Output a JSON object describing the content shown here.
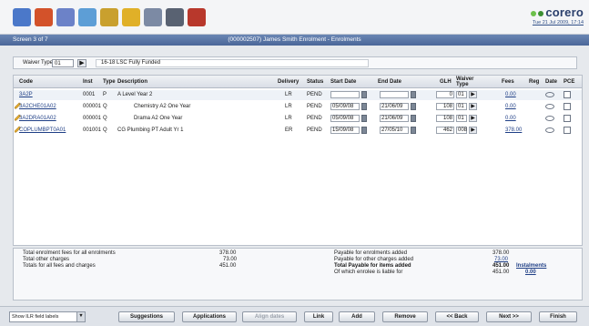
{
  "app": {
    "brand": "corero",
    "datetime": "Tue 21 Jul 2009, 17:14",
    "screen_label": "Screen 3 of 7",
    "window_title": "(000002507) James Smith Enrolment - Enrolments"
  },
  "toolbar": {
    "icons": [
      {
        "name": "home-icon",
        "color": "#4b78c9"
      },
      {
        "name": "students-icon",
        "color": "#d3522a"
      },
      {
        "name": "attachment-icon",
        "color": "#6c82c8"
      },
      {
        "name": "tasks-icon",
        "color": "#5d9ed6"
      },
      {
        "name": "search-icon",
        "color": "#c9a02e"
      },
      {
        "name": "edit-icon",
        "color": "#e0b028"
      },
      {
        "name": "calendar-icon",
        "color": "#7c8aa4"
      },
      {
        "name": "print-icon",
        "color": "#596272"
      },
      {
        "name": "briefcase-icon",
        "color": "#b8382c"
      }
    ]
  },
  "waiver": {
    "label": "Waiver Type",
    "value": "01",
    "description": "16-18 LSC Fully Funded"
  },
  "grid": {
    "headers": {
      "code": "Code",
      "inst": "Inst",
      "type": "Type",
      "description": "Description",
      "delivery": "Delivery",
      "status": "Status",
      "start_date": "Start Date",
      "end_date": "End Date",
      "glh": "GLH",
      "waiver_type": "Waiver Type",
      "fees": "Fees",
      "reg": "Reg",
      "date": "Date",
      "pce": "PCE"
    },
    "rows": [
      {
        "code": "3A2P",
        "inst": "0001",
        "type": "P",
        "description": "A Level Year 2",
        "delivery": "LR",
        "status": "PEND",
        "start": "",
        "end": "",
        "glh": "0",
        "waiver": "01",
        "fees": "0.00",
        "indent": 0,
        "pen": false
      },
      {
        "code": "3A2CHE01A02",
        "inst": "000001",
        "type": "Q",
        "description": "Chemistry A2 One Year",
        "delivery": "LR",
        "status": "PEND",
        "start": "05/09/08",
        "end": "21/06/09",
        "glh": "108",
        "waiver": "01",
        "fees": "0.00",
        "indent": 1,
        "pen": true
      },
      {
        "code": "3A2DRA01A02",
        "inst": "000001",
        "type": "Q",
        "description": "Drama A2 One Year",
        "delivery": "LR",
        "status": "PEND",
        "start": "05/09/08",
        "end": "21/06/09",
        "glh": "108",
        "waiver": "01",
        "fees": "0.00",
        "indent": 1,
        "pen": true
      },
      {
        "code": "COPLUMBPT0A01",
        "inst": "001001",
        "type": "Q",
        "description": "CG Plumbing PT Adult Yr 1",
        "delivery": "ER",
        "status": "PEND",
        "start": "15/09/08",
        "end": "27/05/10",
        "glh": "462",
        "waiver": "008",
        "fees": "378.00",
        "indent": 0,
        "pen": true
      }
    ]
  },
  "summary": {
    "left": [
      {
        "label": "Total enrolment fees for all enrolments",
        "value": "378.00"
      },
      {
        "label": "Total other charges",
        "value": "73.00"
      },
      {
        "label": "Totals for all fees and charges",
        "value": "451.00"
      }
    ],
    "right": [
      {
        "label": "Payable for enrolments added",
        "value": "378.00",
        "link": false,
        "bold": false
      },
      {
        "label": "Payable for other charges added",
        "value": "73.00",
        "link": true,
        "bold": false
      },
      {
        "label": "Total Payable for items added",
        "value": "451.00",
        "link": false,
        "bold": true
      },
      {
        "label": "Of which enrolee is liable for",
        "value": "451.00",
        "link": false,
        "bold": false
      }
    ],
    "instalments_label": "Instalments",
    "instalments_value": "0.00"
  },
  "footer": {
    "show_select": "Show ILR field labels",
    "buttons": [
      {
        "label": "Suggestions",
        "disabled": false
      },
      {
        "label": "Applications",
        "disabled": false
      },
      {
        "label": "Align dates",
        "disabled": true
      },
      {
        "label": "Link",
        "disabled": false
      },
      {
        "label": "Add",
        "disabled": false
      },
      {
        "label": "Remove",
        "disabled": false
      },
      {
        "label": "<< Back",
        "disabled": false
      },
      {
        "label": "Next >>",
        "disabled": false
      },
      {
        "label": "Finish",
        "disabled": false
      }
    ]
  }
}
